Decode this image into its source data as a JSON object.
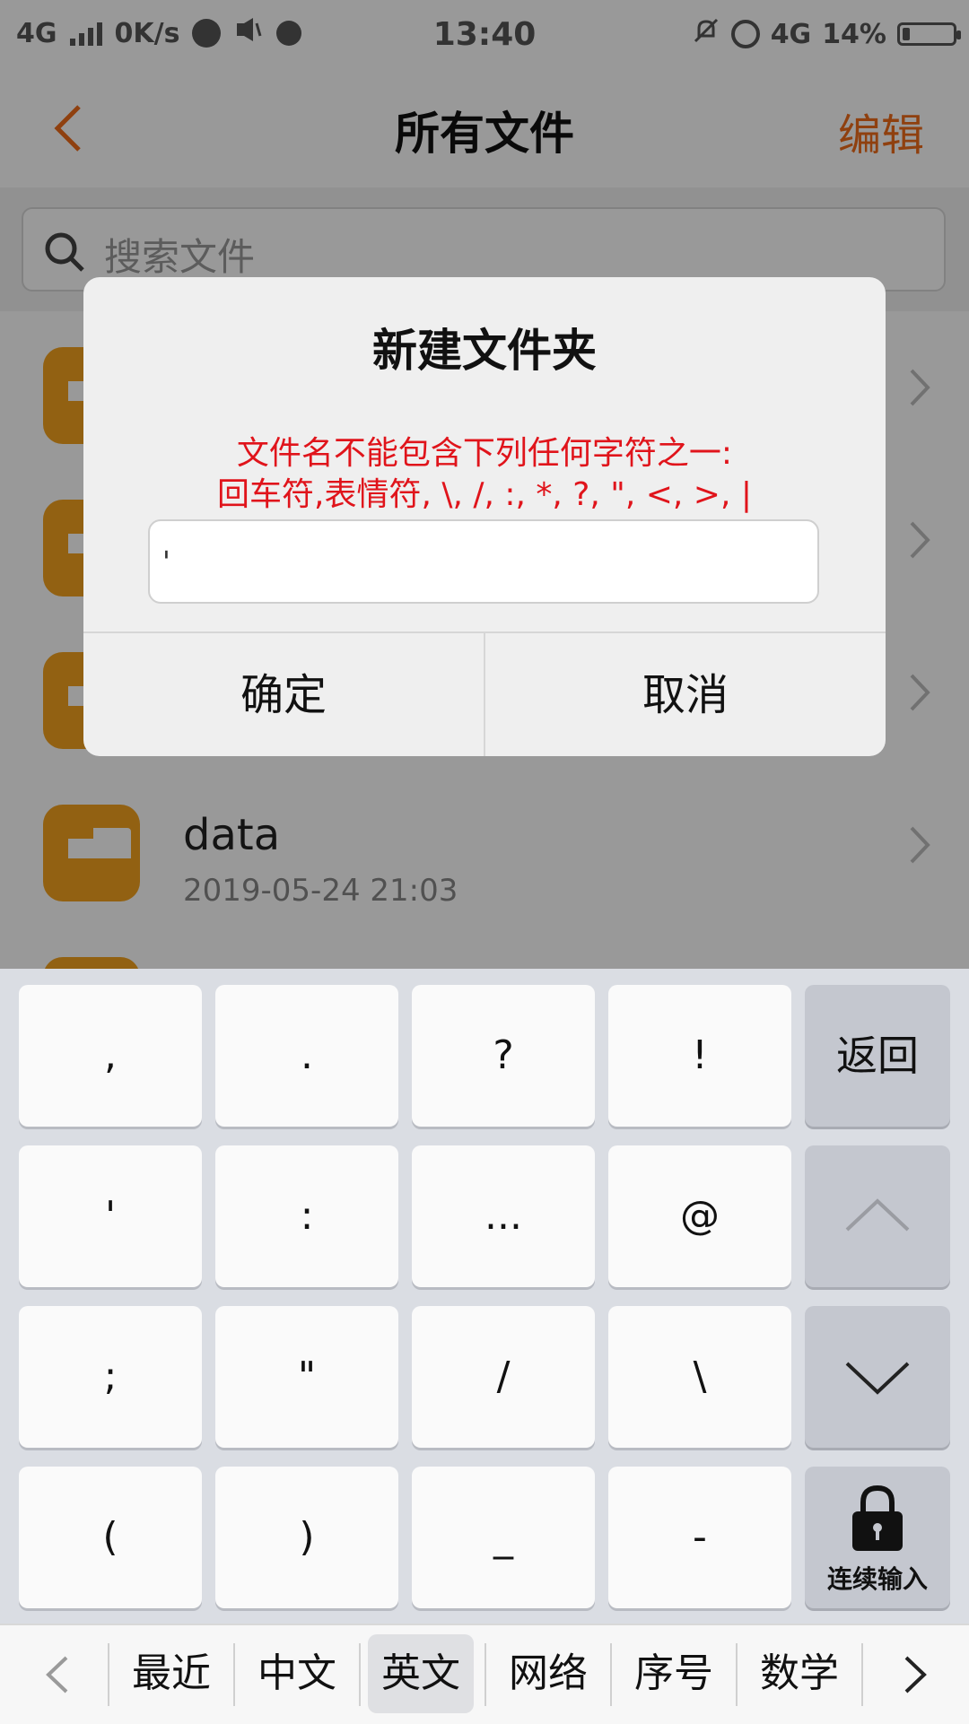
{
  "status_bar": {
    "network": "4G",
    "speed": "0K/s",
    "time": "13:40",
    "network_right": "4G",
    "battery_percent": "14%",
    "battery_level": 0.14
  },
  "header": {
    "title": "所有文件",
    "edit_label": "编辑"
  },
  "search": {
    "placeholder": "搜索文件"
  },
  "files": [
    {
      "name": "",
      "date": ""
    },
    {
      "name": "",
      "date": ""
    },
    {
      "name": "",
      "date": ""
    },
    {
      "name": "data",
      "date": "2019-05-24 21:03"
    }
  ],
  "dialog": {
    "title": "新建文件夹",
    "warning_line1": "文件名不能包含下列任何字符之一:",
    "warning_line2": "回车符,表情符, \\, /, :, *, ?, \", <, >, |",
    "input_value": "'",
    "ok_label": "确定",
    "cancel_label": "取消"
  },
  "keyboard": {
    "rows": [
      [
        ",",
        ".",
        "?",
        "!"
      ],
      [
        "'",
        ":",
        "...",
        "@"
      ],
      [
        ";",
        "\"",
        "/",
        "\\"
      ],
      [
        "(",
        ")",
        "_",
        "-"
      ]
    ],
    "back_label": "返回",
    "lock_label": "连续输入"
  },
  "candidates": {
    "items": [
      "最近",
      "中文",
      "英文",
      "网络",
      "序号",
      "数学"
    ],
    "active": "英文"
  },
  "colors": {
    "accent": "#ef6c1a",
    "folder": "#f3a21f",
    "warning": "#e0141b"
  }
}
